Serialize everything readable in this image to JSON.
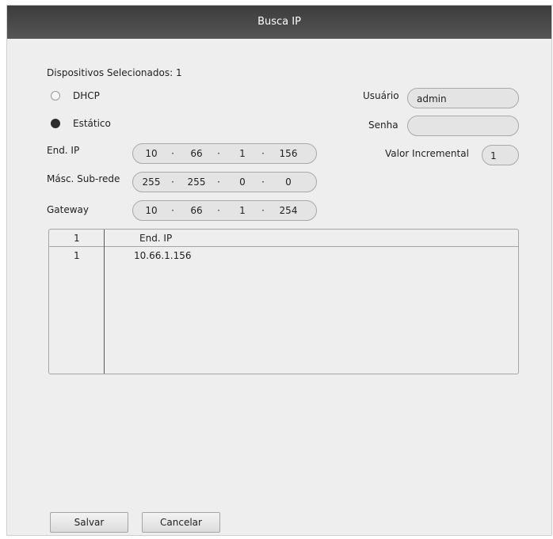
{
  "window": {
    "title": "Busca IP"
  },
  "selected_devices": "Dispositivos Selecionados: 1",
  "mode": {
    "dhcp_label": "DHCP",
    "static_label": "Estático",
    "selected": "Estático"
  },
  "fields": {
    "ip_label": "End. IP",
    "ip": [
      "10",
      "66",
      "1",
      "156"
    ],
    "mask_label": "Másc. Sub-rede",
    "mask": [
      "255",
      "255",
      "0",
      "0"
    ],
    "gateway_label": "Gateway",
    "gateway": [
      "10",
      "66",
      "1",
      "254"
    ],
    "ip_separator": "·"
  },
  "credentials": {
    "user_label": "Usuário",
    "user_value": "admin",
    "password_label": "Senha",
    "password_value": ""
  },
  "increment": {
    "label": "Valor Incremental",
    "value": "1"
  },
  "table": {
    "headers": [
      "1",
      "End. IP"
    ],
    "rows": [
      {
        "index": "1",
        "ip": "10.66.1.156"
      }
    ]
  },
  "buttons": {
    "save": "Salvar",
    "cancel": "Cancelar"
  }
}
